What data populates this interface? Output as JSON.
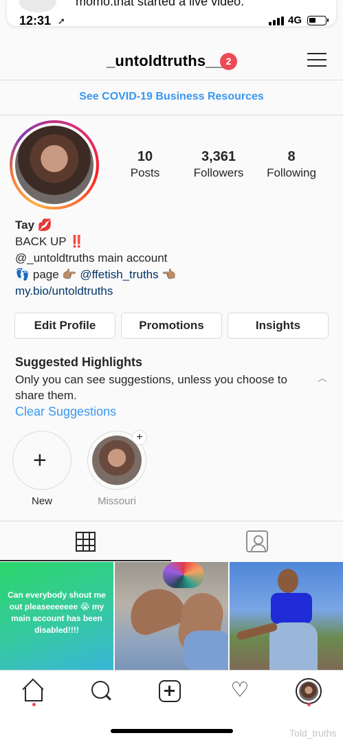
{
  "notification": {
    "text": "momo.that started a live video."
  },
  "status_bar": {
    "time": "12:31",
    "network": "4G",
    "battery_level": 0.3
  },
  "header": {
    "username": "_untoldtruths__",
    "badge_count": "2"
  },
  "covid_banner": {
    "text": "See COVID-19 Business Resources"
  },
  "stats": {
    "posts": {
      "value": "10",
      "label": "Posts"
    },
    "followers": {
      "value": "3,361",
      "label": "Followers"
    },
    "following": {
      "value": "8",
      "label": "Following"
    }
  },
  "bio": {
    "name": "Tay",
    "name_emoji": "💋",
    "line1": "BACK UP",
    "line1_emoji": "‼️",
    "line2": "@_untoldtruths main account",
    "line3_prefix": "👣 page 👉🏽",
    "line3_mention": "@ffetish_truths",
    "line3_suffix": "👈🏽",
    "link": "my.bio/untoldtruths"
  },
  "buttons": {
    "edit_profile": "Edit Profile",
    "promotions": "Promotions",
    "insights": "Insights"
  },
  "suggested": {
    "title": "Suggested Highlights",
    "text": "Only you can see suggestions, unless you choose to share them.",
    "clear": "Clear Suggestions"
  },
  "highlights": {
    "new_label": "New",
    "missouri_label": "Missouri"
  },
  "posts": {
    "post1_text": "Can everybody shout me out pleaseeeeeee 😭 my main account has been disabled!!!!"
  },
  "watermark": "Told_truths",
  "colors": {
    "accent": "#3897f0",
    "badge": "#ed4956",
    "link": "#003569"
  }
}
